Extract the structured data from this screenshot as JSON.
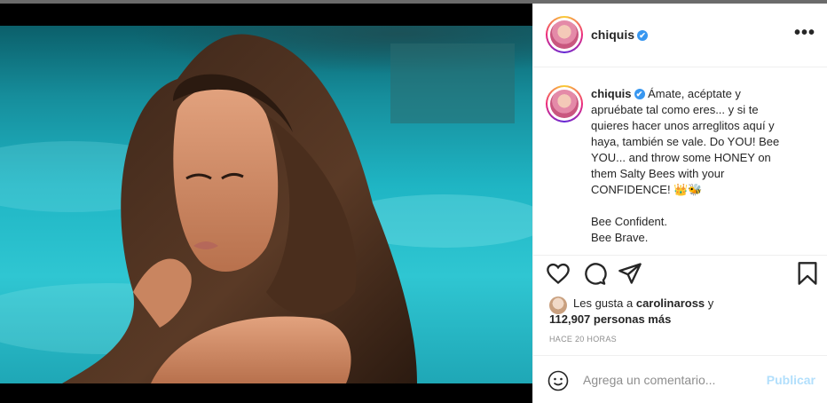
{
  "post": {
    "username": "chiquis",
    "verified_glyph": "✔",
    "more_label": "•••",
    "caption": {
      "username": "chiquis",
      "lines": [
        "Ámate, acéptate y",
        "apruébate tal como eres... y si te",
        "quieres hacer unos arreglitos aquí y",
        "haya, también se vale. Do YOU! Bee",
        "YOU... and throw some HONEY on",
        "them Salty Bees with your",
        "CONFIDENCE! 👑🐝",
        "Bee Confident.",
        "Bee Brave."
      ]
    },
    "likes": {
      "prefix": "Les gusta a",
      "user": "carolinaross",
      "suffix": "y",
      "others": "112,907 personas más"
    },
    "timestamp": "HACE 20 HORAS",
    "comment": {
      "placeholder": "Agrega un comentario...",
      "publish": "Publicar"
    }
  },
  "icons": {
    "like": "heart-icon",
    "comment": "comment-icon",
    "share": "paper-plane-icon",
    "save": "bookmark-icon",
    "emoji": "smiley-icon",
    "more": "more-options-icon"
  },
  "colors": {
    "verified": "#3897f0",
    "publish_disabled": "#b2dffc",
    "muted_text": "#8e8e8e"
  }
}
